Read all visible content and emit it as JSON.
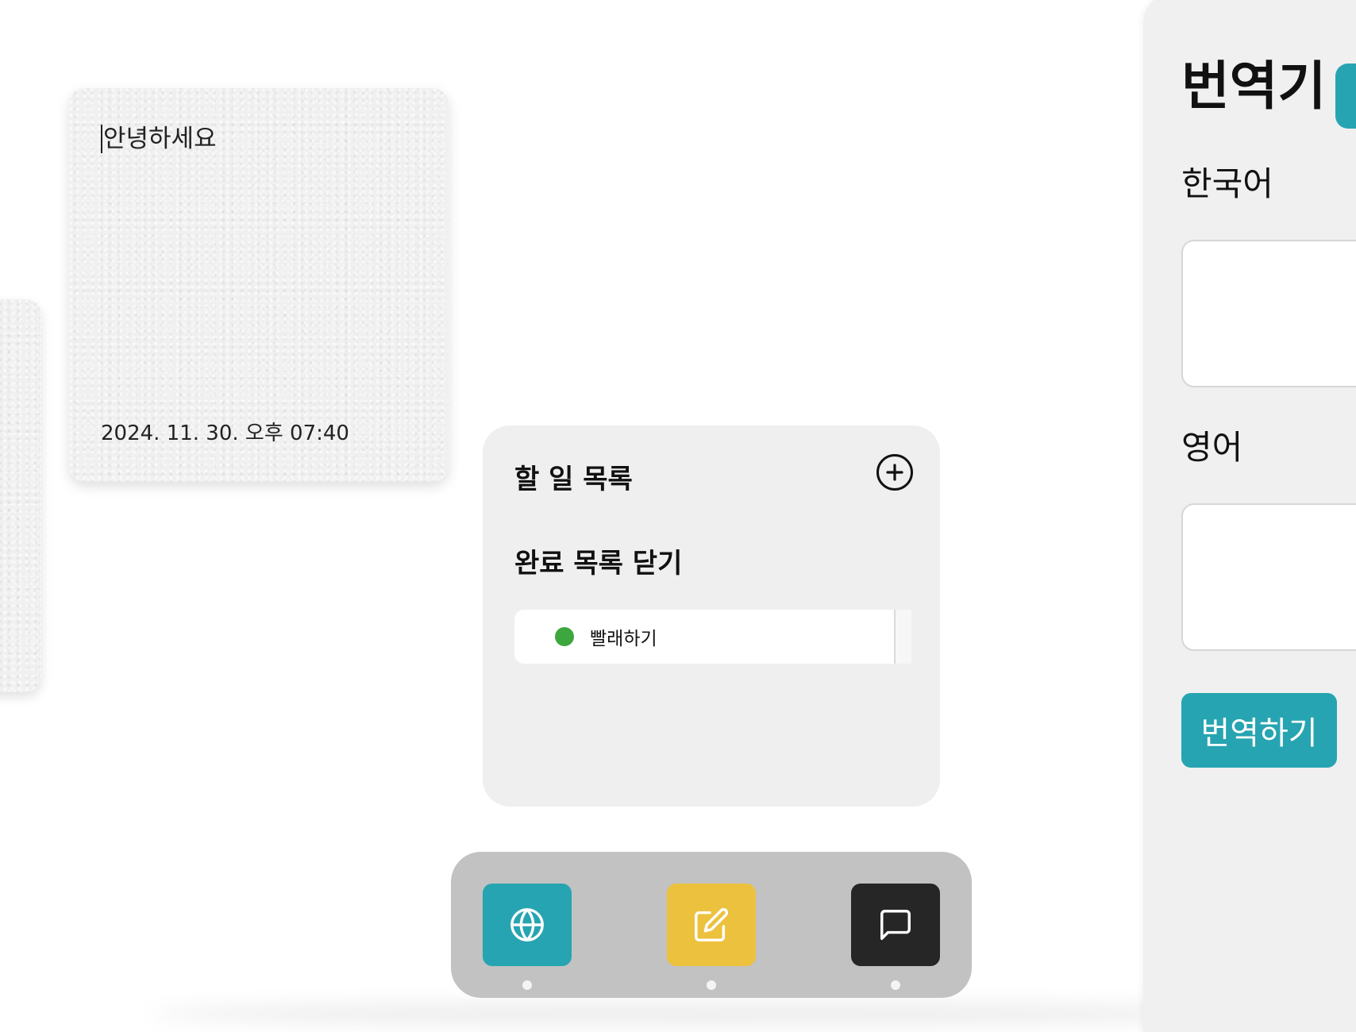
{
  "note": {
    "text": "안녕하세요",
    "date": "2024. 11. 30. 오후 07:40"
  },
  "todo": {
    "title": "할 일 목록",
    "add_icon": "plus-circle-icon",
    "toggle_completed_label": "완료 목록 닫기",
    "items": [
      {
        "label": "빨래하기",
        "status_color": "#3ea63e"
      }
    ]
  },
  "dock": {
    "items": [
      {
        "icon": "globe-icon",
        "color": "#27a4b1"
      },
      {
        "icon": "edit-icon",
        "color": "#ecc13d"
      },
      {
        "icon": "chat-icon",
        "color": "#262626"
      }
    ]
  },
  "translator": {
    "title": "번역기",
    "source_label": "한국어",
    "target_label": "영어",
    "source_value": "",
    "target_value": "",
    "button_label": "번역하기",
    "accent_color": "#27a4b1"
  }
}
